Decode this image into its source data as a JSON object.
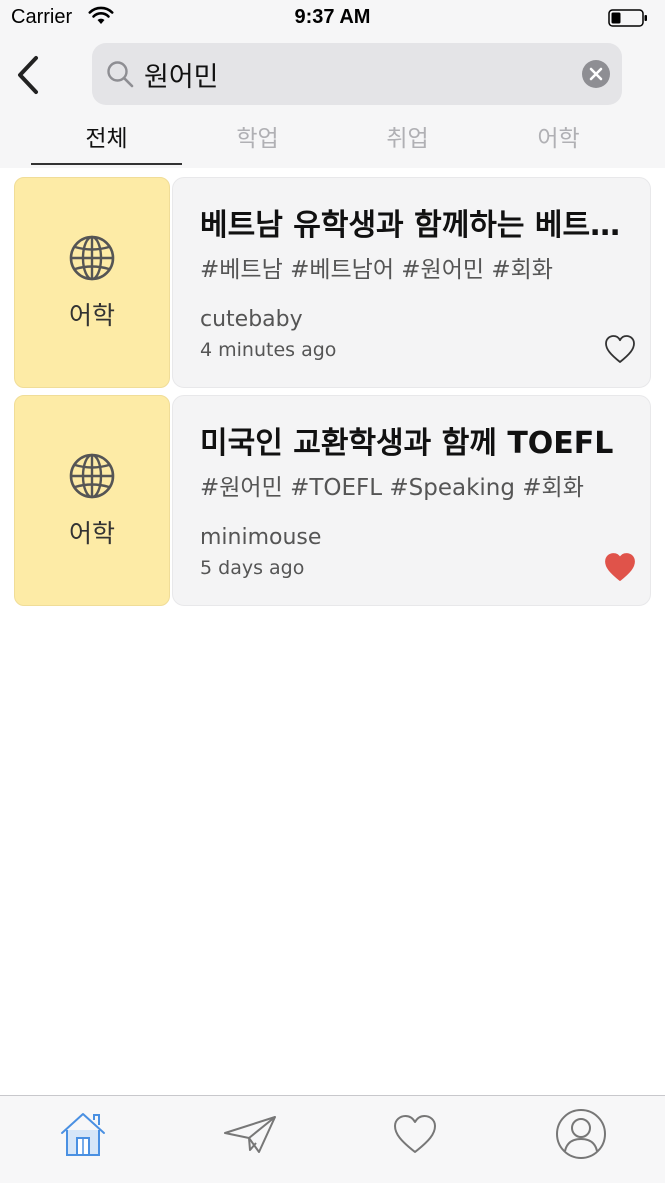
{
  "status_bar": {
    "carrier": "Carrier",
    "time": "9:37 AM"
  },
  "search": {
    "value": "원어민",
    "placeholder": ""
  },
  "tabs": [
    {
      "label": "전체",
      "active": true
    },
    {
      "label": "학업",
      "active": false
    },
    {
      "label": "취업",
      "active": false
    },
    {
      "label": "어학",
      "active": false
    }
  ],
  "results": [
    {
      "category": "어학",
      "title": "베트남 유학생과 함께하는 베트남어 회화",
      "tags": "#베트남 #베트남어 #원어민 #회화",
      "author": "cutebaby",
      "time": "4 minutes ago",
      "liked": false
    },
    {
      "category": "어학",
      "title": "미국인 교환학생과 함께 TOEFL",
      "tags": "#원어민 #TOEFL #Speaking #회화",
      "author": "minimouse",
      "time": "5 days ago",
      "liked": true
    }
  ],
  "tabbar": {
    "items": [
      "home-icon",
      "send-icon",
      "heart-icon",
      "profile-icon"
    ],
    "active": "home-icon"
  },
  "colors": {
    "category_bg": "#fdeba6",
    "liked": "#e0534a",
    "tabbar_active": "#4a90e2",
    "tabbar_inactive": "#8e8e93"
  }
}
